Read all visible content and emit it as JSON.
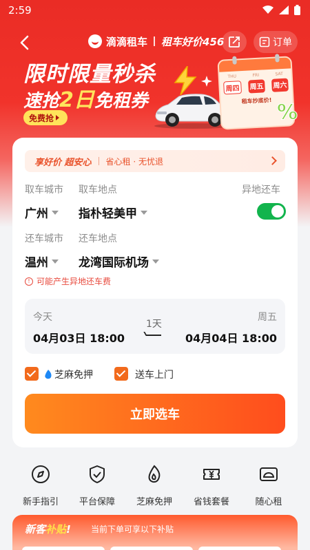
{
  "status": {
    "time": "2:59"
  },
  "header": {
    "brand_name": "滴滴租车",
    "slogan": "租车好价456",
    "order_label": "订单"
  },
  "promo": {
    "title_line1": "限时限量秒杀",
    "title_line2_pre": "速抢",
    "title_line2_hl": "2日",
    "title_line2_post": "免租券",
    "grab_label": "免费抢",
    "calendar": {
      "dow": [
        "THU",
        "FRI",
        "SAT"
      ],
      "days": [
        "周四",
        "周五",
        "周六"
      ],
      "note": "租车抄底价!"
    },
    "percent": "%"
  },
  "booking": {
    "banner_main": "享好价 超安心",
    "banner_sub": "省心租 · 无忧退",
    "pickup_city_label": "取车城市",
    "pickup_point_label": "取车地点",
    "diff_return_label": "异地还车",
    "pickup_city": "广州",
    "pickup_point": "指朴轻美甲",
    "diff_return_enabled": true,
    "return_city_label": "还车城市",
    "return_point_label": "还车地点",
    "return_city": "温州",
    "return_point": "龙湾国际机场",
    "warning": "可能产生异地还车费",
    "start_day": "今天",
    "start_datetime": "04月03日 18:00",
    "duration": "1天",
    "end_day": "周五",
    "end_datetime": "04月04日 18:00",
    "option1": "芝麻免押",
    "option2": "送车上门",
    "cta": "立即选车"
  },
  "quick_links": [
    {
      "label": "新手指引",
      "icon": "compass-icon"
    },
    {
      "label": "平台保障",
      "icon": "shield-check-icon"
    },
    {
      "label": "芝麻免押",
      "icon": "flame-icon"
    },
    {
      "label": "省钱套餐",
      "icon": "yuan-ticket-icon"
    },
    {
      "label": "随心租",
      "icon": "car-card-icon"
    }
  ],
  "subsidy": {
    "title_pre": "新客",
    "title_hl": "补贴",
    "title_post": "!",
    "note": "当前下单可享以下补贴"
  },
  "colors": {
    "primary_red": "#ea2c25",
    "accent_orange": "#ff6a1e",
    "toggle_green": "#12b44d"
  }
}
